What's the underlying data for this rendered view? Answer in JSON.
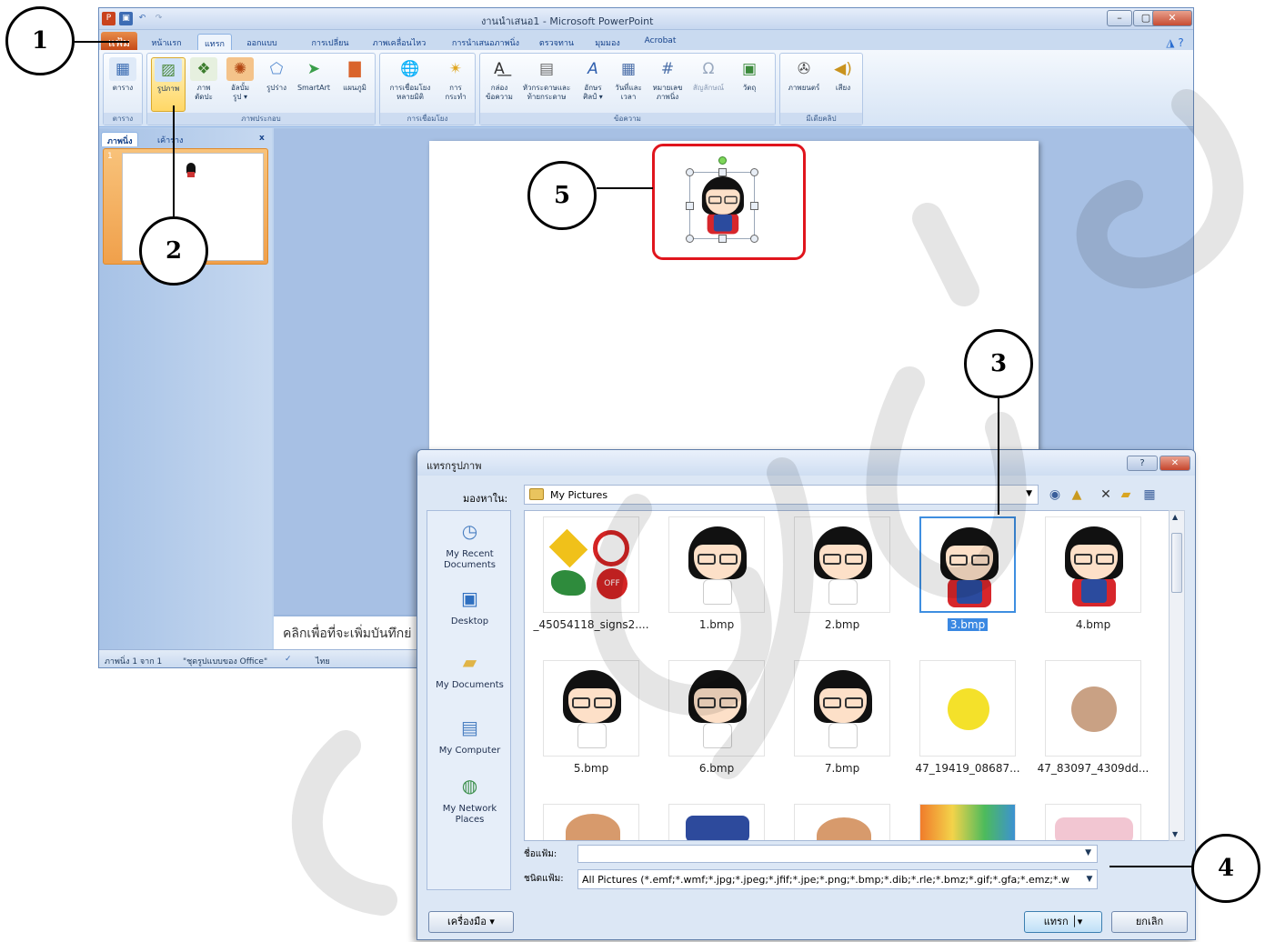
{
  "window": {
    "title": "งานนำเสนอ1 - Microsoft PowerPoint",
    "minimize": "–",
    "restore": "▢",
    "close": "✕"
  },
  "ribbon_tabs": [
    "แฟ้ม",
    "หน้าแรก",
    "แทรก",
    "ออกแบบ",
    "การเปลี่ยน",
    "ภาพเคลื่อนไหว",
    "การนำเสนอภาพนิ่ง",
    "ตรวจทาน",
    "มุมมอง",
    "Acrobat"
  ],
  "ribbon": {
    "table": "ตาราง",
    "picture": "รูปภาพ",
    "clipart": [
      "ภาพ",
      "ตัดปะ"
    ],
    "album": [
      "อัลบั้ม",
      "รูป ▾"
    ],
    "shapes": "รูปร่าง",
    "smartart": "SmartArt",
    "chart": "แผนภูมิ",
    "hyperlink": [
      "การเชื่อมโยง",
      "หลายมิติ"
    ],
    "action": [
      "การ",
      "กระทำ"
    ],
    "textbox": [
      "กล่อง",
      "ข้อความ"
    ],
    "header": [
      "หัวกระดาษและ",
      "ท้ายกระดาษ"
    ],
    "wordart": [
      "อักษร",
      "ศิลป์ ▾"
    ],
    "datetime": [
      "วันที่และ",
      "เวลา"
    ],
    "slidenum": [
      "หมายเลข",
      "ภาพนิ่ง"
    ],
    "symbol": "สัญลักษณ์",
    "object": "วัตถุ",
    "movie": "ภาพยนตร์",
    "sound": "เสียง",
    "groups": [
      "ตาราง",
      "ภาพประกอบ",
      "การเชื่อมโยง",
      "ข้อความ",
      "มีเดียคลิป"
    ]
  },
  "pane_tabs": [
    "ภาพนิ่ง",
    "เค้าร่าง"
  ],
  "slide_number": "1",
  "notes_placeholder": "คลิกเพื่อที่จะเพิ่มบันทึกย่",
  "status": {
    "slide": "ภาพนิ่ง 1 จาก 1",
    "theme": "\"ชุดรูปแบบของ Office\"",
    "lang": "ไทย"
  },
  "dialog": {
    "title": "แทรกรูปภาพ",
    "look_in_label": "มองหาใน:",
    "look_in_value": "My Pictures",
    "places": [
      {
        "label": "My Recent Documents"
      },
      {
        "label": "Desktop"
      },
      {
        "label": "My Documents"
      },
      {
        "label": "My Computer"
      },
      {
        "label": "My Network Places"
      }
    ],
    "files": [
      "_45054118_signs2....",
      "1.bmp",
      "2.bmp",
      "3.bmp",
      "4.bmp",
      "5.bmp",
      "6.bmp",
      "7.bmp",
      "47_19419_08687...",
      "47_83097_4309dd..."
    ],
    "selected_file": "3.bmp",
    "filename_label": "ชื่อแฟ้ม:",
    "filename_value": "",
    "filetype_label": "ชนิดแฟ้ม:",
    "filetype_value": "All Pictures (*.emf;*.wmf;*.jpg;*.jpeg;*.jfif;*.jpe;*.png;*.bmp;*.dib;*.rle;*.bmz;*.gif;*.gfa;*.emz;*.w",
    "tools_button": "เครื่องมือ",
    "insert_button": "แทรก",
    "cancel_button": "ยกเลิก",
    "help": "?",
    "close": "✕"
  },
  "callouts": [
    "1",
    "2",
    "3",
    "4",
    "5"
  ],
  "colors": {
    "file_tab": "#c54a18",
    "selection": "#3a88e2",
    "highlight_box": "#e0151d"
  }
}
